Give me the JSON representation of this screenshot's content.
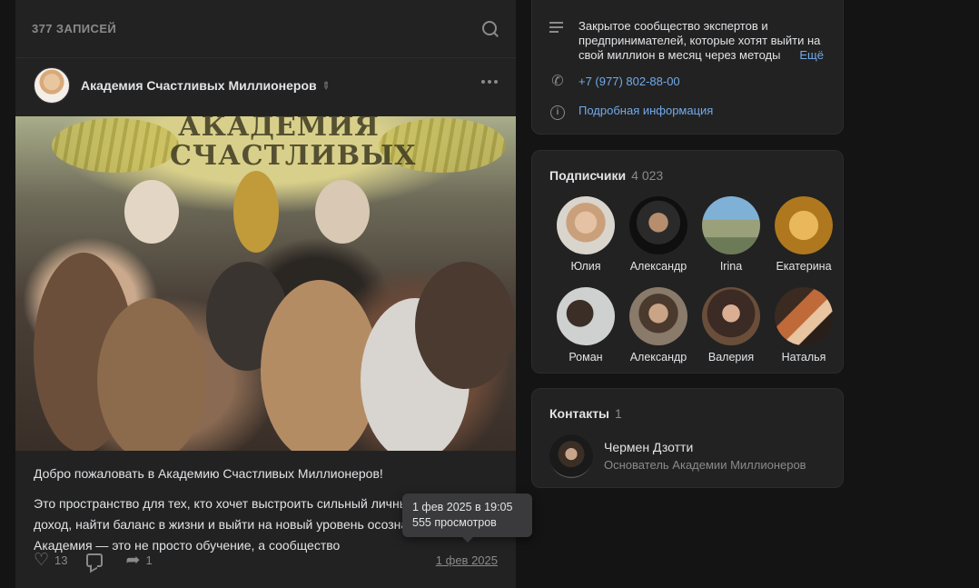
{
  "wall": {
    "count_label": "377 ЗАПИСЕЙ"
  },
  "post": {
    "author": "Академия Счастливых Миллионеров",
    "image_sign": "АКАДЕМИЯ\nСЧАСТЛИВЫХ",
    "text_title": "Добро пожаловать в Академию Счастливых Миллионеров!",
    "text_body": "Это пространство для тех, кто хочет выстроить сильный личный б... увеличить доход, найти баланс в жизни и выйти на новый уровень осознанности. Академия — это не просто обучение, а сообщество",
    "likes": "13",
    "reposts": "1",
    "date": "1 фев 2025",
    "tooltip": {
      "datetime": "1 фев 2025 в 19:05",
      "views": "555 просмотров"
    }
  },
  "info": {
    "description": "Закрытое сообщество экспертов и предпринимателей, которые хотят выйти на свой миллион в месяц через методы",
    "more_label": "Ещё",
    "phone": "+7 (977) 802-88-00",
    "details_label": "Подробная информация"
  },
  "subscribers": {
    "title": "Подписчики",
    "count": "4 023",
    "items": [
      {
        "name": "Юлия"
      },
      {
        "name": "Александр"
      },
      {
        "name": "Irina"
      },
      {
        "name": "Екатерина"
      },
      {
        "name": "Роман"
      },
      {
        "name": "Александр"
      },
      {
        "name": "Валерия"
      },
      {
        "name": "Наталья"
      }
    ]
  },
  "contacts": {
    "title": "Контакты",
    "count": "1",
    "items": [
      {
        "name": "Чермен Дзотти",
        "role": "Основатель Академии Миллионеров"
      }
    ]
  },
  "colors": {
    "background": "#141414",
    "card": "#222222",
    "link": "#71aaeb",
    "muted": "#8a8a8a"
  }
}
